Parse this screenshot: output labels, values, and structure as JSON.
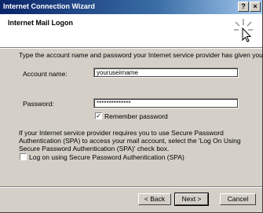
{
  "window": {
    "title": "Internet Connection Wizard",
    "help_glyph": "?",
    "close_glyph": "×"
  },
  "header": {
    "heading": "Internet Mail Logon",
    "icon": "wizard-sparkle-icon"
  },
  "form": {
    "intro": "Type the account name and password your Internet service provider has given you.",
    "account_label": "Account name:",
    "account_value": "youruseirname",
    "password_label": "Password:",
    "password_value": "**************",
    "remember_label": "Remember password",
    "remember_checked": true,
    "remember_glyph": "✓",
    "spa_info": "If your Internet service provider requires you to use Secure Password Authentication (SPA) to access your mail account, select the 'Log On Using Secure Password Authentication (SPA)' check box.",
    "spa_label": "Log on using Secure Password Authentication (SPA)",
    "spa_checked": false
  },
  "buttons": {
    "back": "< Back",
    "next": "Next >",
    "cancel": "Cancel"
  }
}
